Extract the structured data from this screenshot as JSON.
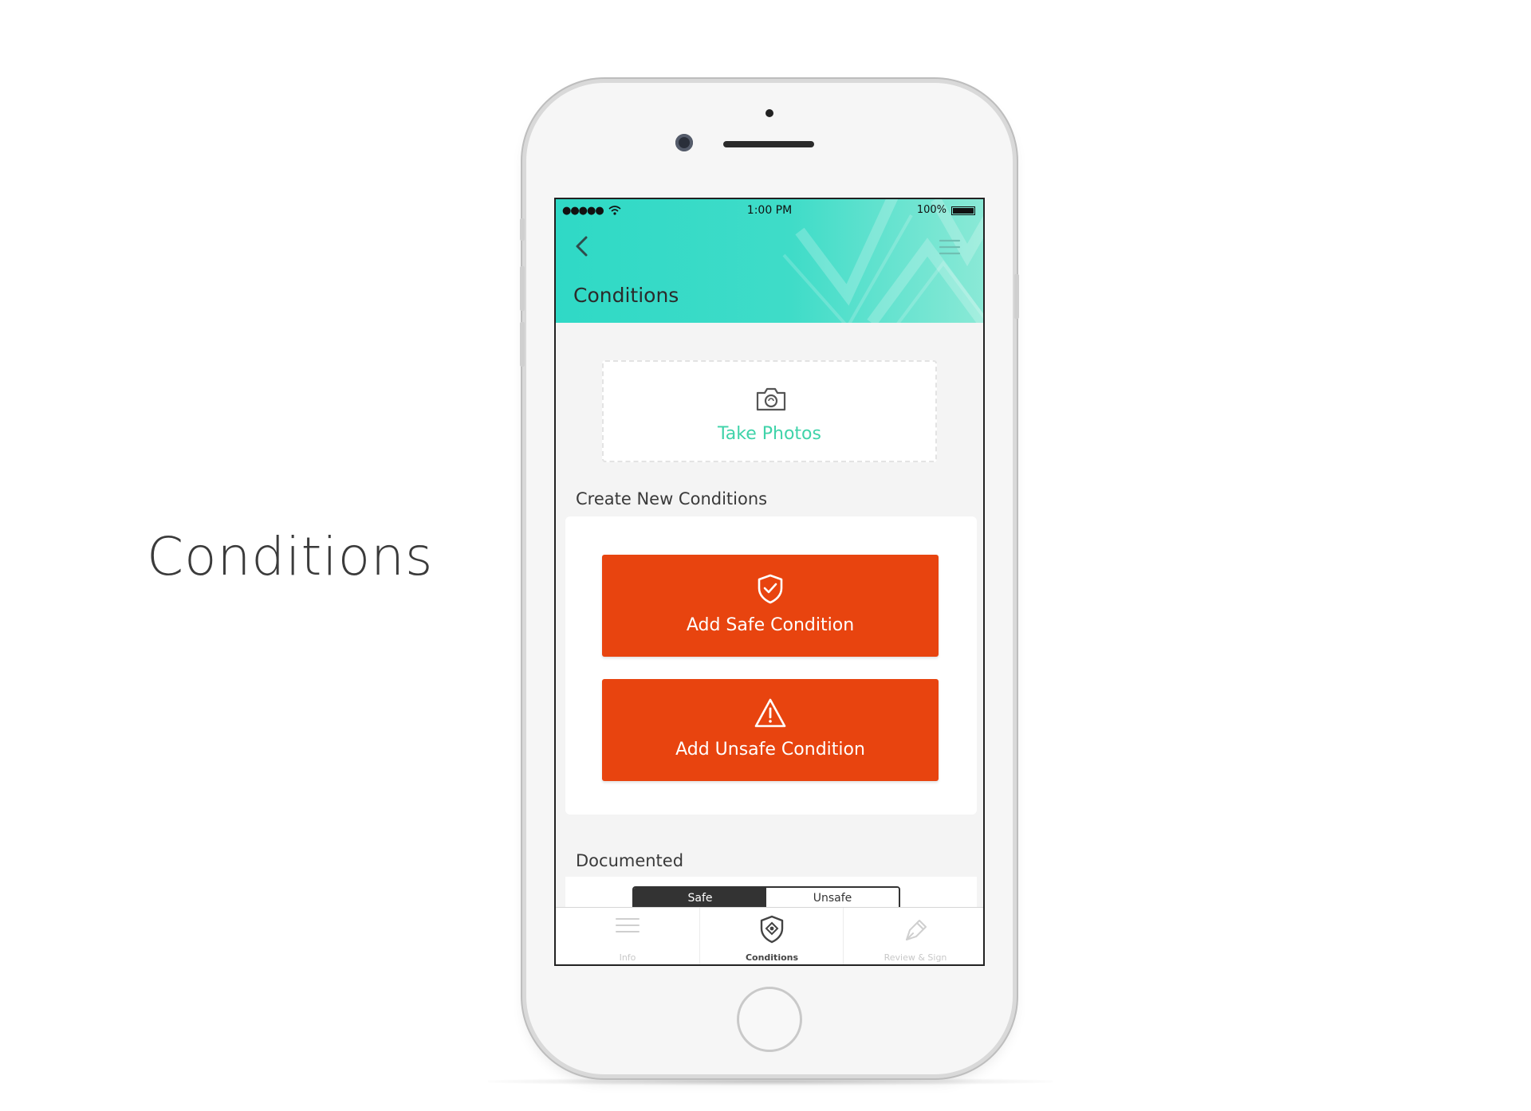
{
  "page": {
    "side_title": "Conditions"
  },
  "status_bar": {
    "signal": "●●●●●",
    "time": "1:00 PM",
    "battery": "100%"
  },
  "header": {
    "title": "Conditions",
    "back_icon": "chevron-left-icon",
    "menu_icon": "hamburger-menu-icon"
  },
  "photos": {
    "label": "Take Photos",
    "icon": "camera-icon"
  },
  "create_section": {
    "label": "Create New Conditions",
    "safe_button": {
      "label": "Add Safe Condition",
      "icon": "shield-check-icon"
    },
    "unsafe_button": {
      "label": "Add Unsafe Condition",
      "icon": "warning-triangle-icon"
    }
  },
  "documented_section": {
    "label": "Documented",
    "segments": [
      "Safe",
      "Unsafe"
    ],
    "selected": "Safe"
  },
  "tab_bar": {
    "tabs": [
      {
        "label": "Info",
        "icon": "list-icon",
        "active": false
      },
      {
        "label": "Conditions",
        "icon": "shield-icon",
        "active": true
      },
      {
        "label": "Review & Sign",
        "icon": "pen-icon",
        "active": false
      }
    ]
  },
  "colors": {
    "accent": "#2fd9c6",
    "action": "#e8440f",
    "link": "#3fd3a9"
  }
}
